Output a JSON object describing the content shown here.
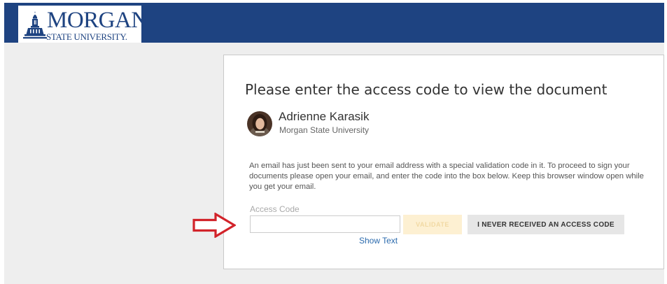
{
  "header": {
    "logo": {
      "name": "MORGAN",
      "sub": "STATE UNIVERSITY.",
      "icon": "morgan-state-tower-icon"
    }
  },
  "card": {
    "title": "Please enter the access code to view the document",
    "sender": {
      "name": "Adrienne Karasik",
      "organization": "Morgan State University",
      "avatar": "avatar-photo"
    },
    "instructions": "An email has just been sent to your email address with a special validation code in it. To proceed to sign your documents please open your email, and enter the code into the box below. Keep this browser window open while you get your email.",
    "access_code": {
      "label": "Access Code",
      "value": "",
      "placeholder": ""
    },
    "validate_label": "VALIDATE",
    "never_received_label": "I NEVER RECEIVED AN ACCESS CODE",
    "show_text_label": "Show Text"
  },
  "annotation": {
    "icon": "red-arrow-right-icon",
    "color": "#d2232a"
  },
  "colors": {
    "brand": "#1e4381",
    "background": "#eeeeee",
    "link": "#2a6aad",
    "validate_disabled": "#fdf0d2"
  }
}
